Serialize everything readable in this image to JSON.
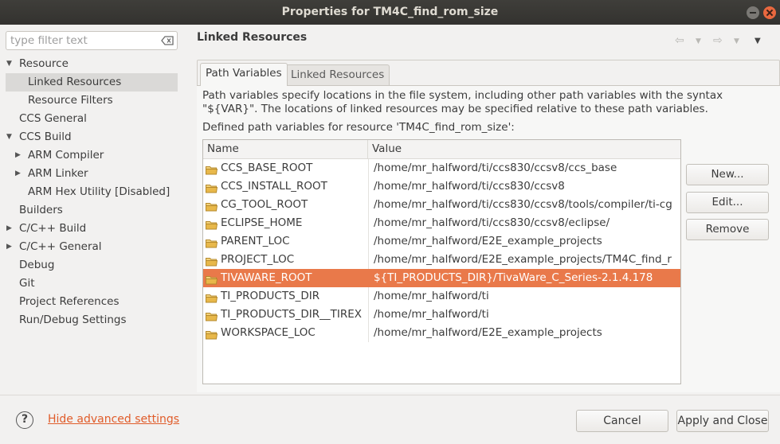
{
  "window": {
    "title": "Properties for TM4C_find_rom_size"
  },
  "sidebar": {
    "filter_placeholder": "type filter text",
    "items": [
      {
        "label": "Resource",
        "level": 0,
        "expanded": true
      },
      {
        "label": "Linked Resources",
        "level": 1,
        "selected": true
      },
      {
        "label": "Resource Filters",
        "level": 1
      },
      {
        "label": "CCS General",
        "level": 0
      },
      {
        "label": "CCS Build",
        "level": 0,
        "expanded": true
      },
      {
        "label": "ARM Compiler",
        "level": 1,
        "collapsed": true
      },
      {
        "label": "ARM Linker",
        "level": 1,
        "collapsed": true
      },
      {
        "label": "ARM Hex Utility  [Disabled]",
        "level": 1
      },
      {
        "label": "Builders",
        "level": 0
      },
      {
        "label": "C/C++ Build",
        "level": 0,
        "collapsed": true
      },
      {
        "label": "C/C++ General",
        "level": 0,
        "collapsed": true
      },
      {
        "label": "Debug",
        "level": 0
      },
      {
        "label": "Git",
        "level": 0
      },
      {
        "label": "Project References",
        "level": 0
      },
      {
        "label": "Run/Debug Settings",
        "level": 0
      }
    ]
  },
  "main": {
    "title": "Linked Resources",
    "tabs": [
      {
        "label": "Path Variables",
        "active": true
      },
      {
        "label": "Linked Resources",
        "active": false
      }
    ],
    "description": "Path variables specify locations in the file system, including other path variables with the syntax \"${VAR}\". The locations of linked resources may be specified relative to these path variables.",
    "defined_label": "Defined path variables for resource 'TM4C_find_rom_size':",
    "table": {
      "columns": [
        "Name",
        "Value"
      ],
      "rows": [
        {
          "name": "CCS_BASE_ROOT",
          "value": "/home/mr_halfword/ti/ccs830/ccsv8/ccs_base"
        },
        {
          "name": "CCS_INSTALL_ROOT",
          "value": "/home/mr_halfword/ti/ccs830/ccsv8"
        },
        {
          "name": "CG_TOOL_ROOT",
          "value": "/home/mr_halfword/ti/ccs830/ccsv8/tools/compiler/ti-cg"
        },
        {
          "name": "ECLIPSE_HOME",
          "value": "/home/mr_halfword/ti/ccs830/ccsv8/eclipse/"
        },
        {
          "name": "PARENT_LOC",
          "value": "/home/mr_halfword/E2E_example_projects"
        },
        {
          "name": "PROJECT_LOC",
          "value": "/home/mr_halfword/E2E_example_projects/TM4C_find_r"
        },
        {
          "name": "TIVAWARE_ROOT",
          "value": "${TI_PRODUCTS_DIR}/TivaWare_C_Series-2.1.4.178",
          "selected": true
        },
        {
          "name": "TI_PRODUCTS_DIR",
          "value": "/home/mr_halfword/ti"
        },
        {
          "name": "TI_PRODUCTS_DIR__TIREX",
          "value": "/home/mr_halfword/ti"
        },
        {
          "name": "WORKSPACE_LOC",
          "value": "/home/mr_halfword/E2E_example_projects"
        }
      ]
    },
    "buttons": {
      "new": "New...",
      "edit": "Edit...",
      "remove": "Remove"
    }
  },
  "footer": {
    "advanced_link": "Hide advanced settings",
    "cancel": "Cancel",
    "apply_close": "Apply and Close"
  },
  "colors": {
    "selection": "#e9794a",
    "link": "#e05c2a",
    "titlebar": "#3a3935"
  }
}
